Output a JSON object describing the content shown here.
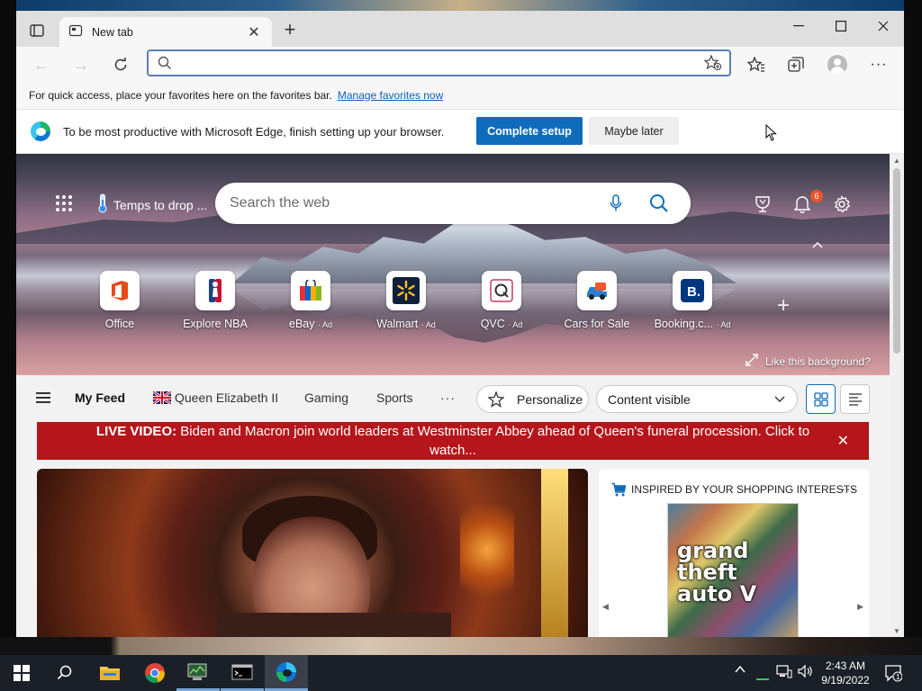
{
  "browser": {
    "tab_title": "New tab",
    "address_value": ""
  },
  "favorites_bar": {
    "message": "For quick access, place your favorites here on the favorites bar.",
    "link": "Manage favorites now"
  },
  "setup_bar": {
    "message": "To be most productive with Microsoft Edge, finish setting up your browser.",
    "primary_button": "Complete setup",
    "secondary_button": "Maybe later"
  },
  "hero": {
    "weather_text": "Temps to drop ...",
    "search_placeholder": "Search the web",
    "notification_count": "6",
    "like_background": "Like this background?"
  },
  "top_sites": [
    {
      "label": "Office",
      "ad": "",
      "icon": "office-icon"
    },
    {
      "label": "Explore NBA",
      "ad": "",
      "icon": "nba-icon"
    },
    {
      "label": "eBay",
      "ad": "· Ad",
      "icon": "ebay-icon"
    },
    {
      "label": "Walmart",
      "ad": "· Ad",
      "icon": "walmart-icon"
    },
    {
      "label": "QVC",
      "ad": "· Ad",
      "icon": "qvc-icon"
    },
    {
      "label": "Cars for Sale",
      "ad": "",
      "icon": "cars-icon"
    },
    {
      "label": "Booking.c...",
      "ad": "· Ad",
      "icon": "booking-icon"
    }
  ],
  "feed_nav": {
    "my_feed": "My Feed",
    "items": [
      "Queen Elizabeth II",
      "Gaming",
      "Sports"
    ],
    "more": "···",
    "personalize": "Personalize",
    "content_select": "Content visible"
  },
  "breaking": {
    "prefix": "LIVE VIDEO:",
    "text": "Biden and Macron join world leaders at Westminster Abbey ahead of Queen's funeral procession. Click to watch..."
  },
  "shopping_card": {
    "title": "INSPIRED BY YOUR SHOPPING INTERESTS",
    "more": "···",
    "product_art_text": "grand theft auto V"
  },
  "taskbar": {
    "time": "2:43 AM",
    "date": "9/19/2022",
    "notification_count": "1"
  },
  "colors": {
    "accent": "#0f6cbd",
    "breaking_red": "#b5161b",
    "taskbar": "#1b1f27"
  }
}
